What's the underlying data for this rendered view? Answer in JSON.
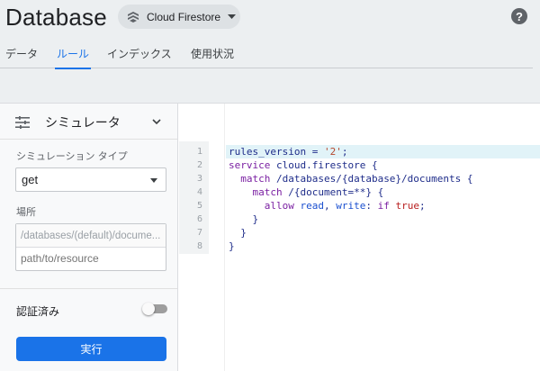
{
  "header": {
    "title": "Database",
    "db_selector": "Cloud Firestore",
    "help": "?"
  },
  "tabs": [
    {
      "label": "データ",
      "active": false
    },
    {
      "label": "ルール",
      "active": true
    },
    {
      "label": "インデックス",
      "active": false
    },
    {
      "label": "使用状況",
      "active": false
    }
  ],
  "simulator": {
    "title": "シミュレータ",
    "type_label": "シミュレーション タイプ",
    "type_value": "get",
    "location_label": "場所",
    "location_prefix": "/databases/(default)/docume...",
    "location_placeholder": "path/to/resource",
    "auth_label": "認証済み",
    "auth_enabled": false,
    "run_label": "実行"
  },
  "editor": {
    "line_numbers": [
      "1",
      "2",
      "3",
      "4",
      "5",
      "6",
      "7",
      "8"
    ],
    "lines": [
      "rules_version = '2';",
      "service cloud.firestore {",
      "  match /databases/{database}/documents {",
      "    match /{document=**} {",
      "      allow read, write: if true;",
      "    }",
      "  }",
      "}"
    ],
    "tokens": {
      "l1_a": "rules_version = ",
      "l1_b": "'2'",
      "l1_c": ";",
      "l2_a": "service",
      "l2_b": " cloud.firestore {",
      "l3_a": "  match",
      "l3_b": " /databases/{database}/documents {",
      "l4_a": "    match",
      "l4_b": " /{document=**} {",
      "l5_a": "      allow",
      "l5_b": " read",
      "l5_c": ", ",
      "l5_d": "write",
      "l5_e": ": ",
      "l5_f": "if",
      "l5_g": " ",
      "l5_h": "true",
      "l5_i": ";",
      "l6": "    }",
      "l7": "  }",
      "l8": "}"
    }
  },
  "colors": {
    "accent": "#1a73e8",
    "background": "#eceff1",
    "highlight_line": "#e1f3f8"
  }
}
